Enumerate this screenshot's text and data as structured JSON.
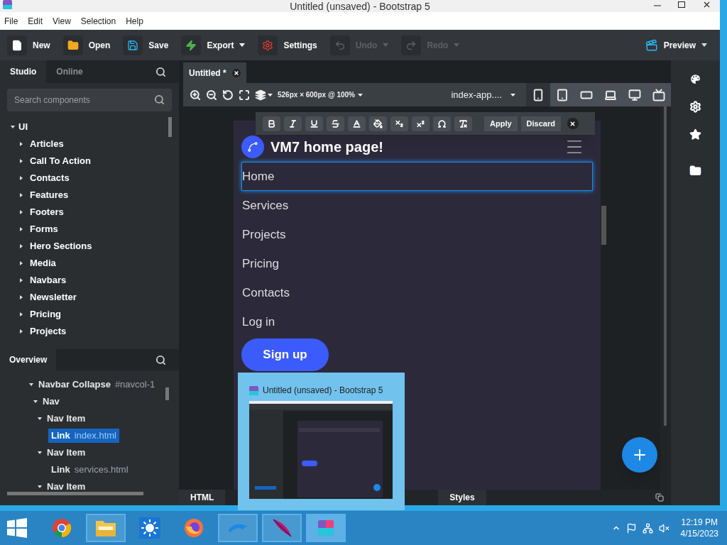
{
  "window": {
    "title": "Untitled (unsaved) - Bootstrap 5"
  },
  "menu": [
    "File",
    "Edit",
    "View",
    "Selection",
    "Help"
  ],
  "toolbar": [
    {
      "label": "New",
      "kind": "new",
      "disabled": false,
      "dropdown": false
    },
    {
      "label": "Open",
      "kind": "open",
      "disabled": false,
      "dropdown": false
    },
    {
      "label": "Save",
      "kind": "save",
      "disabled": false,
      "dropdown": false
    },
    {
      "label": "Export",
      "kind": "export",
      "disabled": false,
      "dropdown": true
    },
    {
      "label": "Settings",
      "kind": "settings",
      "disabled": false,
      "dropdown": false
    },
    {
      "label": "Undo",
      "kind": "undo",
      "disabled": true,
      "dropdown": true
    },
    {
      "label": "Redo",
      "kind": "redo",
      "disabled": true,
      "dropdown": true
    }
  ],
  "preview_button": {
    "label": "Preview"
  },
  "sidebar": {
    "tabs": [
      {
        "label": "Studio",
        "selected": true
      },
      {
        "label": "Online",
        "selected": false
      }
    ],
    "search": {
      "placeholder": "Search components"
    },
    "components": [
      {
        "label": "UI",
        "expanded": true,
        "children": [
          {
            "label": "Articles",
            "expanded": false
          },
          {
            "label": "Call To Action",
            "expanded": false
          },
          {
            "label": "Contacts",
            "expanded": false
          },
          {
            "label": "Features",
            "expanded": false
          },
          {
            "label": "Footers",
            "expanded": false
          },
          {
            "label": "Forms",
            "expanded": false
          },
          {
            "label": "Hero Sections",
            "expanded": false
          },
          {
            "label": "Media",
            "expanded": false
          },
          {
            "label": "Navbars",
            "expanded": false
          },
          {
            "label": "Newsletter",
            "expanded": false
          },
          {
            "label": "Pricing",
            "expanded": false
          },
          {
            "label": "Projects",
            "expanded": false
          }
        ]
      }
    ],
    "overview": {
      "title": "Overview",
      "tree": [
        {
          "label": "Navbar Collapse",
          "detail": "#navcol-1",
          "selected": false,
          "children": [
            {
              "label": "Nav",
              "selected": false,
              "children": [
                {
                  "label": "Nav Item",
                  "selected": false,
                  "children": [
                    {
                      "label": "Link",
                      "detail": "index.html",
                      "selected": true
                    }
                  ]
                },
                {
                  "label": "Nav Item",
                  "selected": false,
                  "children": [
                    {
                      "label": "Link",
                      "detail": "services.html",
                      "selected": false
                    }
                  ]
                },
                {
                  "label": "Nav Item",
                  "selected": false,
                  "expanded": true
                }
              ]
            }
          ]
        }
      ]
    }
  },
  "document_tab": {
    "label": "Untitled *"
  },
  "canvas_toolbar": {
    "size": "526px × 600px @ 100%",
    "page": "index-app....",
    "devices": [
      {
        "kind": "phone"
      },
      {
        "kind": "tablet"
      },
      {
        "kind": "tablet-landscape"
      },
      {
        "kind": "laptop"
      },
      {
        "kind": "desktop"
      },
      {
        "kind": "monitor"
      }
    ]
  },
  "format_toolbar": {
    "tools": [
      {
        "kind": "bold"
      },
      {
        "kind": "italic"
      },
      {
        "kind": "underline"
      },
      {
        "kind": "strike"
      },
      {
        "kind": "color"
      },
      {
        "kind": "fill"
      },
      {
        "kind": "subscript"
      },
      {
        "kind": "superscript"
      },
      {
        "kind": "omega"
      },
      {
        "kind": "clear"
      }
    ],
    "apply": "Apply",
    "discard": "Discard"
  },
  "page": {
    "brand": "VM7 home page!",
    "links": [
      {
        "label": "Home",
        "selected": true
      },
      {
        "label": "Services",
        "selected": false
      },
      {
        "label": "Projects",
        "selected": false
      },
      {
        "label": "Pricing",
        "selected": false
      },
      {
        "label": "Contacts",
        "selected": false
      },
      {
        "label": "Log in",
        "selected": false
      }
    ],
    "signup": "Sign up"
  },
  "bottom_tabs": [
    "HTML",
    "Styles"
  ],
  "taskbar": {
    "apps": [
      {
        "kind": "chrome",
        "active": false,
        "open": false
      },
      {
        "kind": "explorer",
        "active": false,
        "open": true
      },
      {
        "kind": "sun",
        "active": false,
        "open": false
      },
      {
        "kind": "firefox",
        "active": false,
        "open": false
      },
      {
        "kind": "dolphin",
        "active": false,
        "open": true
      },
      {
        "kind": "feather",
        "active": false,
        "open": true
      },
      {
        "kind": "bootstrap",
        "active": true,
        "open": true
      }
    ],
    "time": "12:19 PM",
    "date": "4/15/2023"
  },
  "thumbnail": {
    "title": "Untitled (unsaved) - Bootstrap 5"
  }
}
